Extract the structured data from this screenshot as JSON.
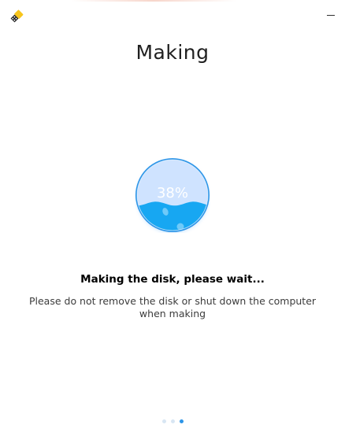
{
  "window": {
    "app_icon": "usb-disk-writer-icon",
    "minimize_icon": "minimize-icon"
  },
  "main": {
    "title": "Making",
    "progress": {
      "percent": 38,
      "label": "38%"
    },
    "status_text": "Making the disk, please wait...",
    "hint_text": "Please do not remove the disk or shut down the computer when making"
  },
  "pager": {
    "steps": 3,
    "active_step": 3
  },
  "colors": {
    "accent": "#2d95e8",
    "water": "#17a7f2",
    "circle_bg": "#cfe3ff",
    "title_text": "#202020"
  }
}
